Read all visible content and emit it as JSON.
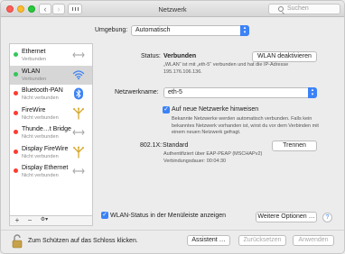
{
  "window": {
    "title": "Netzwerk"
  },
  "toolbar": {
    "back": "‹",
    "forward": "›",
    "search_placeholder": "Suchen"
  },
  "environment": {
    "label": "Umgebung:",
    "value": "Automatisch"
  },
  "services": [
    {
      "name": "Ethernet",
      "status": "Verbunden",
      "dot": "#34c759",
      "icon": "ethernet-icon"
    },
    {
      "name": "WLAN",
      "status": "Verbunden",
      "dot": "#34c759",
      "icon": "wifi-icon"
    },
    {
      "name": "Bluetooth-PAN",
      "status": "Nicht verbunden",
      "dot": "#ff3b30",
      "icon": "bluetooth-icon"
    },
    {
      "name": "FireWire",
      "status": "Nicht verbunden",
      "dot": "#ff3b30",
      "icon": "firewire-icon"
    },
    {
      "name": "Thunde…t Bridge",
      "status": "Nicht verbunden",
      "dot": "#ff3b30",
      "icon": "thunderbolt-bridge-icon"
    },
    {
      "name": "Display FireWire",
      "status": "Nicht verbunden",
      "dot": "#ff3b30",
      "icon": "firewire-icon"
    },
    {
      "name": "Display Ethernet",
      "status": "Nicht verbunden",
      "dot": "#ff3b30",
      "icon": "ethernet-icon"
    }
  ],
  "sidebar_footer": {
    "add": "+",
    "remove": "−",
    "actions": "⚙▾"
  },
  "detail": {
    "status_label": "Status:",
    "status_value": "Verbunden",
    "wlan_off_button": "WLAN deaktivieren",
    "status_desc_1": "„WLAN“ ist mit „eth-5“ verbunden und hat die IP-Adresse",
    "status_desc_2": "195.176.106.136.",
    "network_name_label": "Netzwerkname:",
    "network_name_value": "eth-5",
    "ask_new_label": "Auf neue Netzwerke hinweisen",
    "ask_new_checked": true,
    "ask_new_desc_1": "Bekannte Netzwerke werden automatisch verbunden. Falls kein",
    "ask_new_desc_2": "bekanntes Netzwerk vorhanden ist, wirst du vor dem Verbinden mit",
    "ask_new_desc_3": "einem neuen Netzwerk gefragt.",
    "x8021_label": "802.1X:",
    "x8021_value": "Standard",
    "disconnect_button": "Trennen",
    "auth_text": "Authentifiziert über EAP-PEAP (MSCHAPv2)",
    "duration_text": "Verbindungsdauer: 00:04:30",
    "menubar_label": "WLAN-Status in der Menüleiste anzeigen",
    "menubar_checked": true,
    "advanced_button": "Weitere Optionen …",
    "help": "?"
  },
  "bottom": {
    "lock_text": "Zum Schützen auf das Schloss klicken.",
    "assistant": "Assistent …",
    "revert": "Zurücksetzen",
    "apply": "Anwenden"
  },
  "colors": {
    "accent": "#3b82f6",
    "connected": "#34c759",
    "disconnected": "#ff3b30"
  }
}
